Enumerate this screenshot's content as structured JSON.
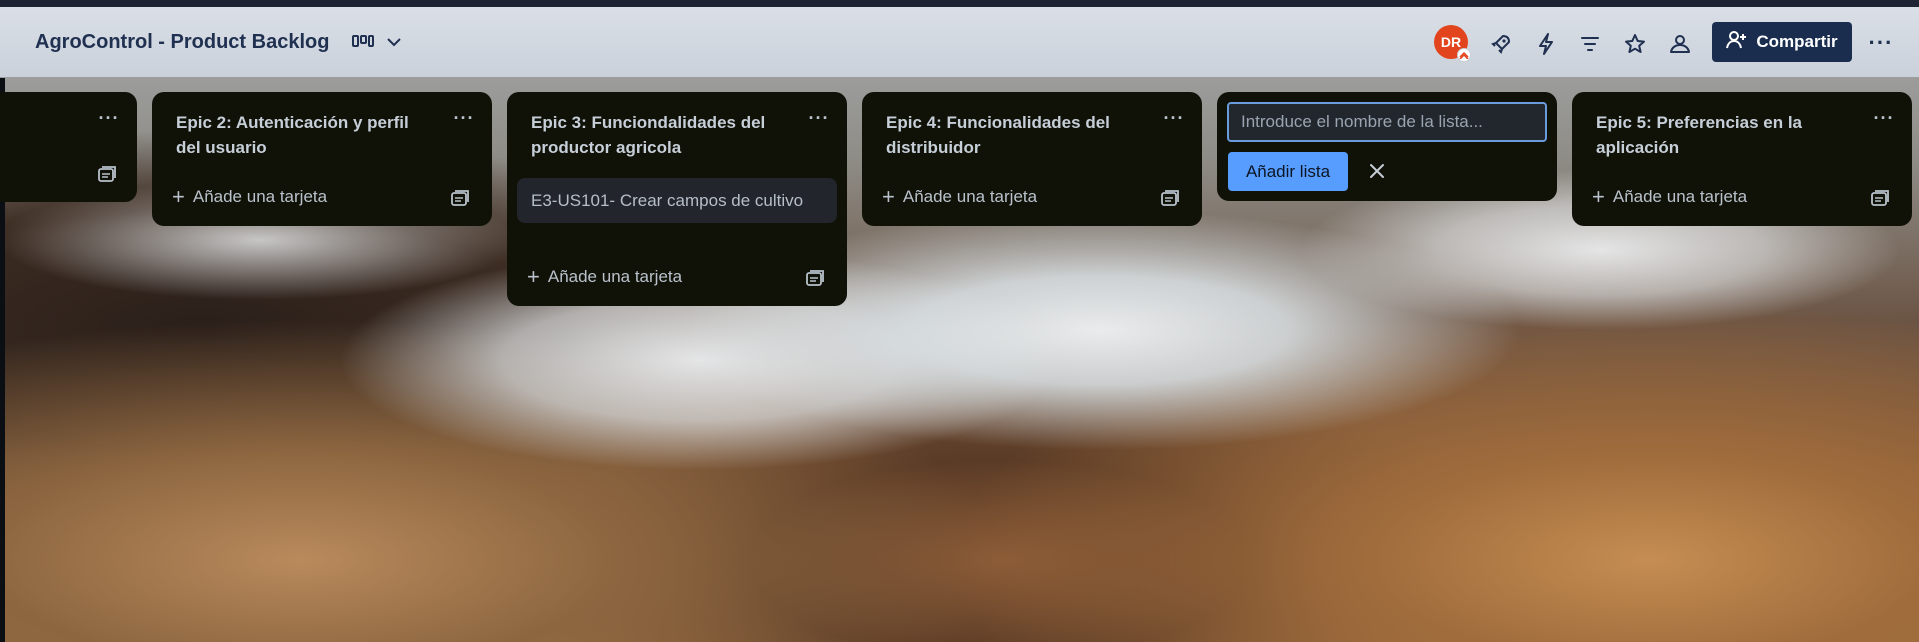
{
  "header": {
    "board_title": "AgroControl - Product Backlog",
    "view_icon": "board-view-icon",
    "avatar_initials": "DR",
    "share_label": "Compartir",
    "more_label": "···",
    "icons": [
      "rocket-icon",
      "lightning-icon",
      "filter-icon",
      "star-icon",
      "workspace-visibility-icon"
    ]
  },
  "lists": [
    {
      "title": "",
      "menu_label": "···"
    },
    {
      "title": "Epic 2: Autenticación y perfil del usuario",
      "menu_label": "···",
      "add_card_label": "Añade una tarjeta"
    },
    {
      "title": "Epic 3: Funciondalidades del productor agricola",
      "menu_label": "···",
      "cards": [
        "E3-US101- Crear campos de cultivo"
      ],
      "add_card_label": "Añade una tarjeta"
    },
    {
      "title": "Epic 4: Funcionalidades del distribuidor",
      "menu_label": "···",
      "add_card_label": "Añade una tarjeta"
    },
    {
      "title": "Epic 5: Preferencias en la aplicación",
      "menu_label": "···",
      "add_card_label": "Añade una tarjeta"
    }
  ],
  "new_list": {
    "placeholder": "Introduce el nombre de la lista...",
    "value": "",
    "add_button_label": "Añadir lista"
  },
  "colors": {
    "accent": "#579dff",
    "share_button": "#1b2d4f",
    "avatar": "#e2451e",
    "list_bg": "#101107",
    "card_bg": "#22252b"
  }
}
